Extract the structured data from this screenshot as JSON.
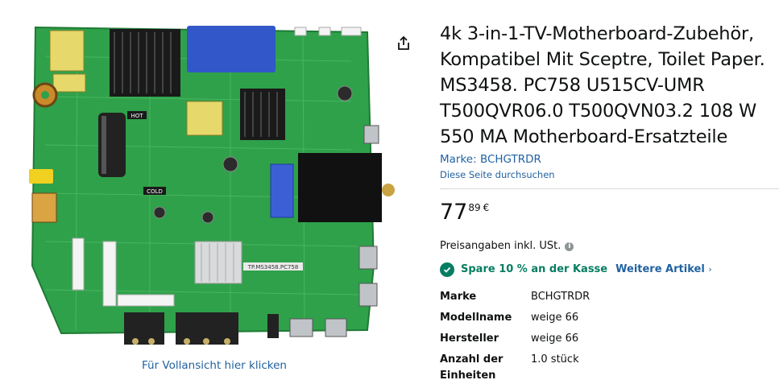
{
  "product": {
    "title": "4k 3-in-1-TV-Motherboard-Zubehör, Kompatibel Mit Sceptre, Toilet Paper. MS3458. PC758 U515CV-UMR T500QVR06.0 T500QVN03.2 108 W 550 MA Motherboard-Ersatzteile",
    "brand_link": "Marke: BCHGTRDR",
    "search_page_link": "Diese Seite durchsuchen",
    "image_alt": "TV-Motherboard"
  },
  "gallery": {
    "fullview_link": "Für Vollansicht hier klicken",
    "share_icon": "share-icon"
  },
  "board_labels": {
    "hot": "HOT",
    "cold": "COLD",
    "model_tag": "TP.MS3458.PC758"
  },
  "price": {
    "whole": "77",
    "fraction": "89",
    "currency": "€"
  },
  "tax": {
    "text": "Preisangaben inkl. USt.",
    "icon": "info-icon"
  },
  "savings": {
    "text": "Spare 10 % an der Kasse",
    "more_link": "Weitere Artikel",
    "icon": "checkmark-icon",
    "color": "#067d62"
  },
  "specs": [
    {
      "label": "Marke",
      "value": "BCHGTRDR"
    },
    {
      "label": "Modellname",
      "value": "weige 66"
    },
    {
      "label": "Hersteller",
      "value": "weige 66"
    },
    {
      "label": "Anzahl der Einheiten",
      "value": "1.0 stück"
    }
  ],
  "colors": {
    "link": "#2162a1",
    "text": "#0f1111",
    "pcb_green": "#2fa14a"
  }
}
